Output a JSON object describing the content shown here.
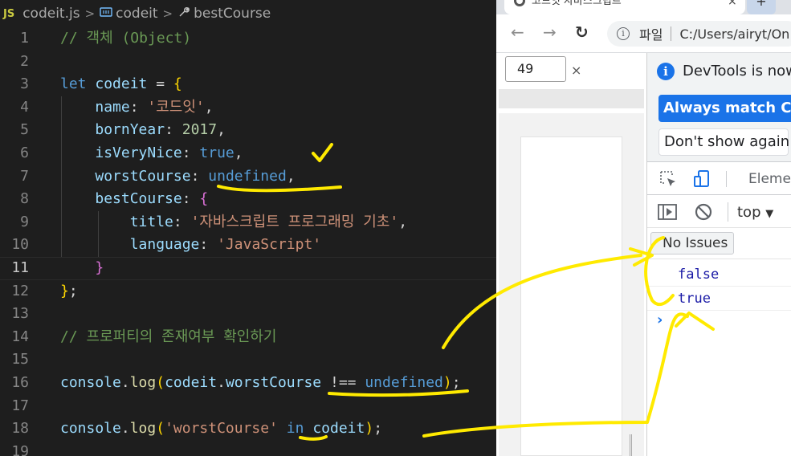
{
  "editor": {
    "breadcrumb": {
      "lang_badge": "JS",
      "file": "codeit.js",
      "symbol1": "codeit",
      "symbol2": "bestCourse",
      "sep": ">"
    },
    "line_numbers": [
      "1",
      "2",
      "3",
      "4",
      "5",
      "6",
      "7",
      "8",
      "9",
      "10",
      "11",
      "12",
      "13",
      "14",
      "15",
      "16",
      "17",
      "18",
      "19"
    ],
    "code": {
      "l1_comment": "// 객체 (Object)",
      "l3_let": "let",
      "l3_name": "codeit",
      "l3_eq": " = ",
      "l3_brace": "{",
      "l4_key": "name",
      "l4_colon": ": ",
      "l4_val": "'코드잇'",
      "l4_comma": ",",
      "l5_key": "bornYear",
      "l5_colon": ": ",
      "l5_val": "2017",
      "l5_comma": ",",
      "l6_key": "isVeryNice",
      "l6_colon": ": ",
      "l6_val": "true",
      "l6_comma": ",",
      "l7_key": "worstCourse",
      "l7_colon": ": ",
      "l7_val": "undefined",
      "l7_comma": ",",
      "l8_key": "bestCourse",
      "l8_colon": ": ",
      "l8_brace": "{",
      "l9_key": "title",
      "l9_colon": ": ",
      "l9_val": "'자바스크립트 프로그래밍 기초'",
      "l9_comma": ",",
      "l10_key": "language",
      "l10_colon": ": ",
      "l10_val": "'JavaScript'",
      "l11_brace": "}",
      "l12_brace": "}",
      "l12_semi": ";",
      "l14_comment": "// 프로퍼티의 존재여부 확인하기",
      "l16_console": "console",
      "l16_dot": ".",
      "l16_log": "log",
      "l16_paren_open": "(",
      "l16_obj": "codeit",
      "l16_dot2": ".",
      "l16_prop": "worstCourse",
      "l16_op": " !== ",
      "l16_val": "undefined",
      "l16_paren_close": ")",
      "l16_semi": ";",
      "l18_console": "console",
      "l18_dot": ".",
      "l18_log": "log",
      "l18_paren_open": "(",
      "l18_str": "'worstCourse'",
      "l18_in": " in ",
      "l18_obj": "codeit",
      "l18_paren_close": ")",
      "l18_semi": ";"
    }
  },
  "browser": {
    "tab_title": "코드잇 자바스크립트",
    "tab_close": "×",
    "new_tab": "+",
    "nav": {
      "back": "←",
      "forward": "→",
      "reload": "↻"
    },
    "omnibox": {
      "info": "i",
      "scheme": "파일",
      "path": "C:/Users/airyt/On"
    },
    "find": {
      "value": "49",
      "close": "×"
    },
    "devtools": {
      "info": "i",
      "message": "DevTools is now",
      "match_button": "Always match Chro",
      "dont_show": "Don't show again",
      "tab_elements": "Eleme",
      "context": "top",
      "context_caret": "▼",
      "issues": "No Issues",
      "output": [
        "false",
        "true"
      ],
      "prompt": "›"
    }
  },
  "colors": {
    "ink": "#ffea00",
    "checkmark": "#ffea00",
    "accent": "#1a73e8"
  }
}
